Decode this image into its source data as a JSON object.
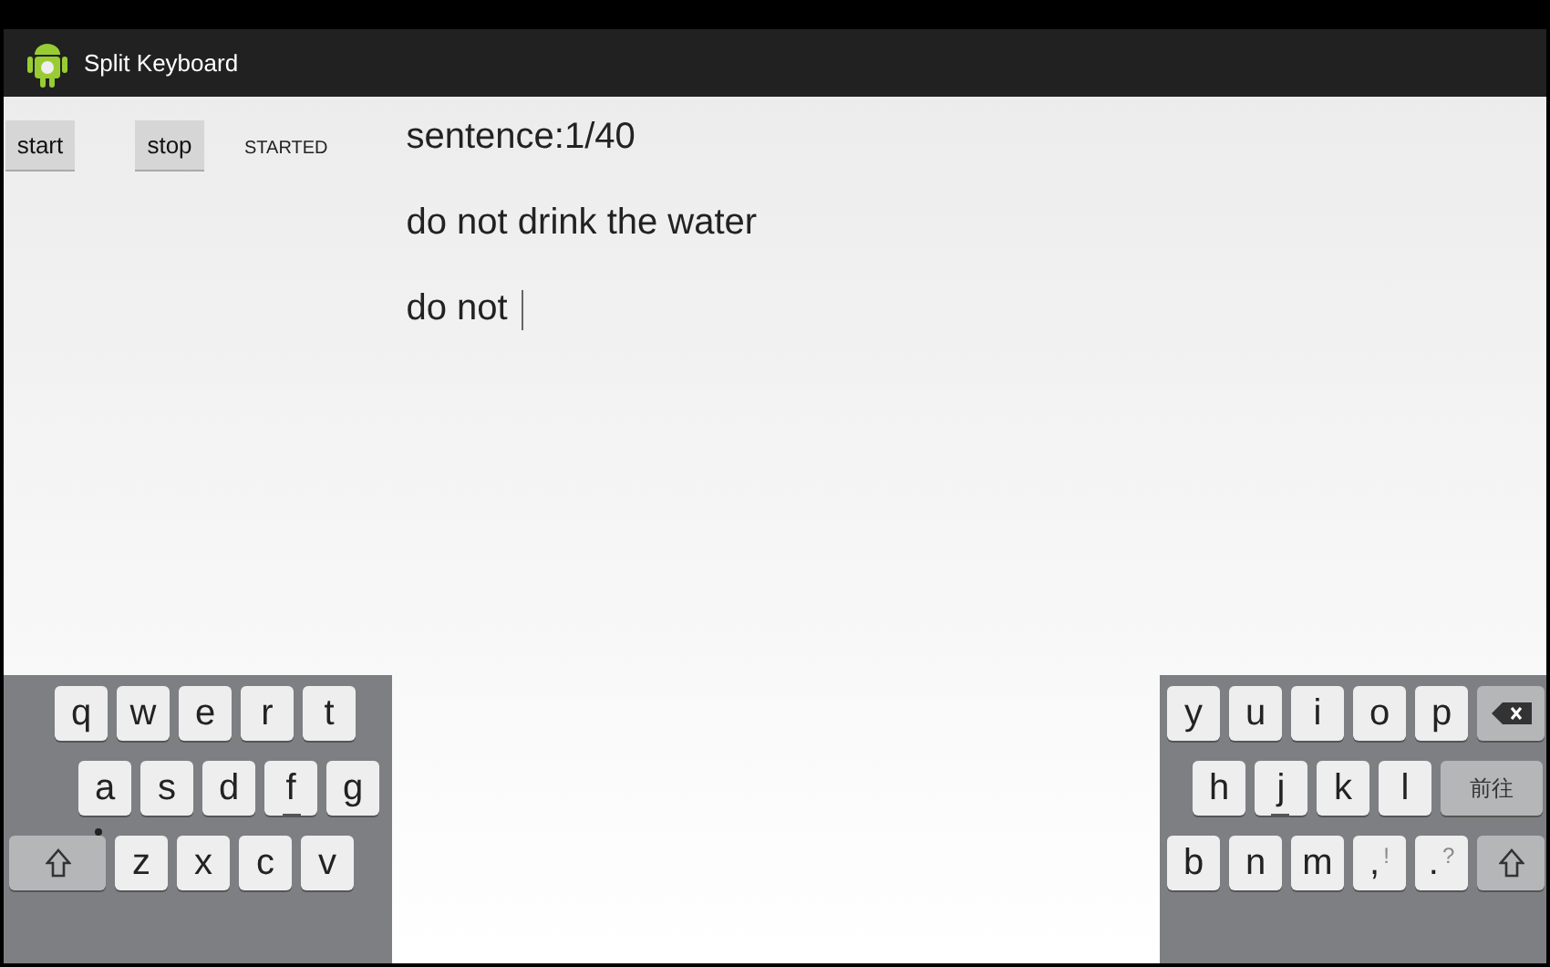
{
  "action_bar": {
    "title": "Split Keyboard"
  },
  "controls": {
    "start_button": "start",
    "stop_button": "stop",
    "status": "STARTED"
  },
  "sentence_counter": "sentence:1/40",
  "target_sentence": "do not drink the water",
  "input": {
    "value": "do not",
    "focused": true
  },
  "keyboard_left": [
    [
      {
        "kind": "letter",
        "label": "q"
      },
      {
        "kind": "letter",
        "label": "w"
      },
      {
        "kind": "letter",
        "label": "e"
      },
      {
        "kind": "letter",
        "label": "r"
      },
      {
        "kind": "letter",
        "label": "t"
      }
    ],
    [
      {
        "kind": "letter",
        "label": "a"
      },
      {
        "kind": "letter",
        "label": "s"
      },
      {
        "kind": "letter",
        "label": "d"
      },
      {
        "kind": "home",
        "label": "f"
      },
      {
        "kind": "letter",
        "label": "g"
      }
    ],
    [
      {
        "kind": "shift",
        "dot": true
      },
      {
        "kind": "letter",
        "label": "z"
      },
      {
        "kind": "letter",
        "label": "x"
      },
      {
        "kind": "letter",
        "label": "c"
      },
      {
        "kind": "letter",
        "label": "v"
      }
    ]
  ],
  "keyboard_right": [
    [
      {
        "kind": "letter",
        "label": "y"
      },
      {
        "kind": "letter",
        "label": "u"
      },
      {
        "kind": "letter",
        "label": "i"
      },
      {
        "kind": "letter",
        "label": "o"
      },
      {
        "kind": "letter",
        "label": "p"
      },
      {
        "kind": "backspace"
      }
    ],
    [
      {
        "kind": "letter",
        "label": "h"
      },
      {
        "kind": "home",
        "label": "j"
      },
      {
        "kind": "letter",
        "label": "k"
      },
      {
        "kind": "letter",
        "label": "l"
      },
      {
        "kind": "action",
        "label": "前往"
      }
    ],
    [
      {
        "kind": "letter",
        "label": "b"
      },
      {
        "kind": "letter",
        "label": "n"
      },
      {
        "kind": "letter",
        "label": "m"
      },
      {
        "kind": "punct",
        "label": ",",
        "hint": "!"
      },
      {
        "kind": "punct",
        "label": ".",
        "hint": "?"
      },
      {
        "kind": "shift",
        "dot": false
      }
    ]
  ]
}
